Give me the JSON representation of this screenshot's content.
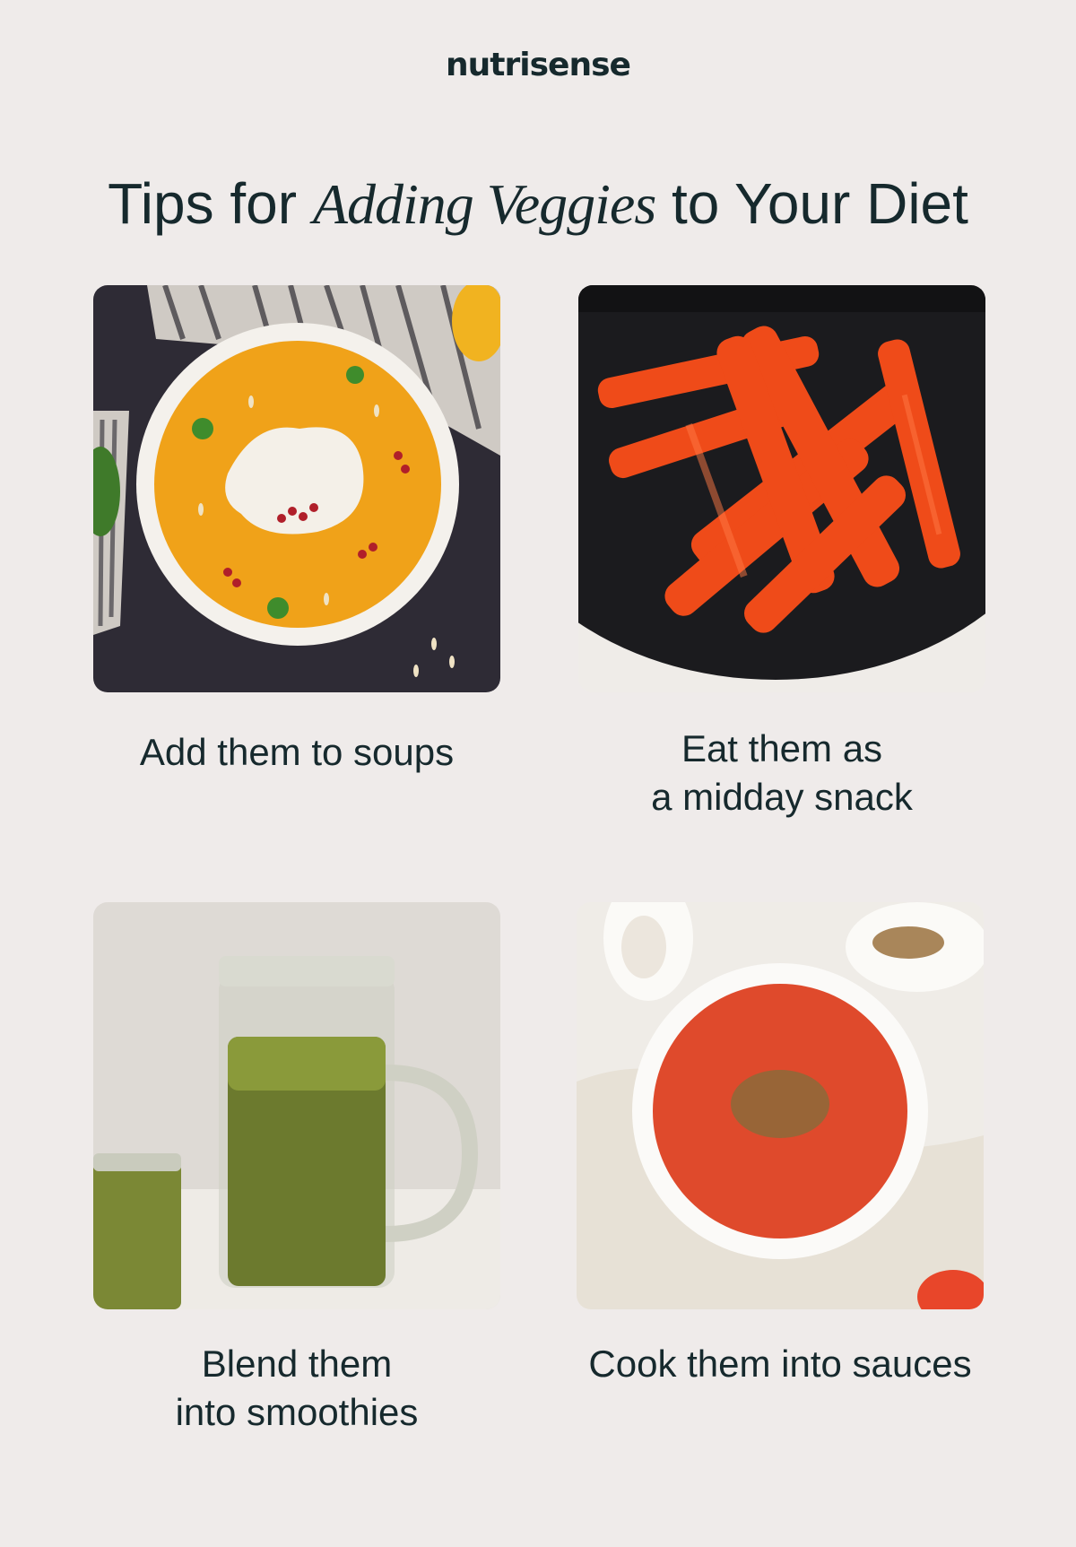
{
  "brand": {
    "name": "nutrisense"
  },
  "header": {
    "title_pre": "Tips for ",
    "title_emphasis": "Adding Veggies",
    "title_post": " to Your Diet"
  },
  "tips": [
    {
      "image": "pumpkin-soup-photo",
      "lines": [
        "Add them to soups"
      ]
    },
    {
      "image": "red-pepper-strips-photo",
      "lines": [
        "Eat them as",
        "a midday snack"
      ]
    },
    {
      "image": "green-smoothie-jar-photo",
      "lines": [
        "Blend them",
        "into smoothies"
      ]
    },
    {
      "image": "tomato-sauce-bowl-photo",
      "lines": [
        "Cook them into sauces"
      ]
    }
  ]
}
